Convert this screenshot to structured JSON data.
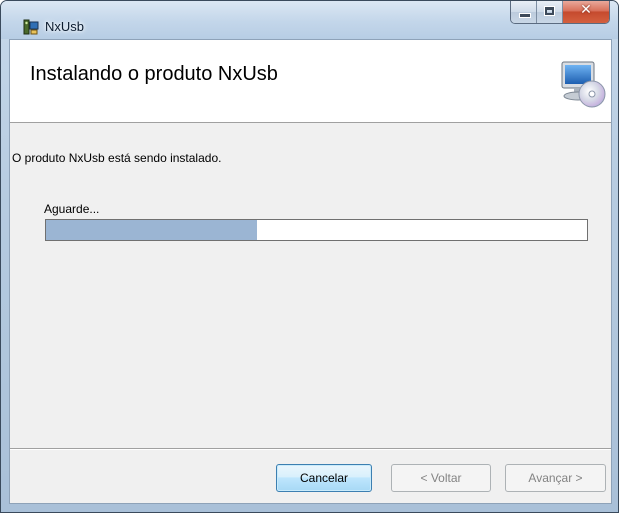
{
  "window": {
    "title": "NxUsb",
    "close_glyph": "✕"
  },
  "banner": {
    "title": "Instalando o produto NxUsb",
    "icon": "computer-with-disc-icon"
  },
  "main": {
    "status_text": "O produto NxUsb está sendo instalado.",
    "wait_label": "Aguarde...",
    "progress_fraction": 0.39
  },
  "buttons": {
    "cancel_label": "Cancelar",
    "back_label": "< Voltar",
    "next_label": "Avançar >"
  },
  "colors": {
    "progress_fill": "#9bb5d3",
    "focused_button_border": "#3c7fb1",
    "disabled_text": "#838383"
  }
}
